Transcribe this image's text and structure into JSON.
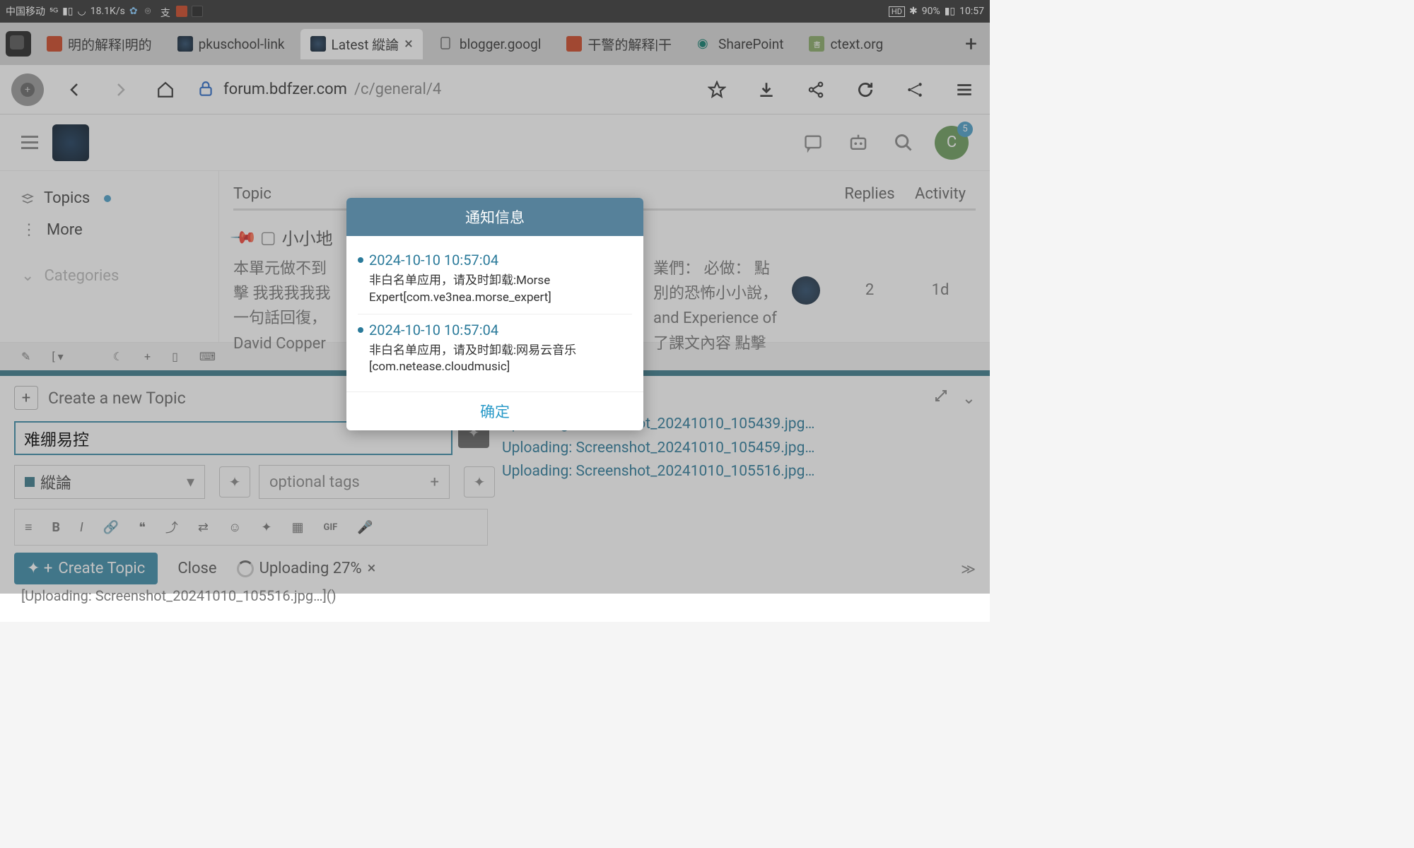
{
  "status": {
    "carrier": "中国移动",
    "speed": "18.1K/s",
    "hd": "HD",
    "battery": "90%",
    "time": "10:57"
  },
  "tabs": [
    {
      "label": "明的解释|明的",
      "favicon": "red"
    },
    {
      "label": "pkuschool-link",
      "favicon": "darklogo"
    },
    {
      "label": "Latest 縱論",
      "favicon": "darklogo",
      "active": true
    },
    {
      "label": "blogger.googl",
      "favicon": "doc"
    },
    {
      "label": "干警的解释|干",
      "favicon": "red"
    },
    {
      "label": "SharePoint",
      "favicon": "sp"
    },
    {
      "label": "ctext.org",
      "favicon": "ct"
    }
  ],
  "url": {
    "host": "forum.bdfzer.com",
    "path": "/c/general/4"
  },
  "page": {
    "avatar_letter": "C",
    "avatar_badge": "5",
    "sidebar": {
      "topics": "Topics",
      "more": "More",
      "categories": "Categories"
    },
    "columns": {
      "topic": "Topic",
      "replies": "Replies",
      "activity": "Activity"
    },
    "topic": {
      "title": "小小地",
      "body_left": "本單元做不到\n擊 我我我我我\n一句話回復，\nDavid Copper",
      "body_right": "業們： 必做： 點\n別的恐怖小小說，\nand Experience of\n了課文內容 點擊",
      "replies": "2",
      "activity": "1d"
    }
  },
  "composer": {
    "heading": "Create a new Topic",
    "title_value": "难绷易控",
    "category": "縱論",
    "tags_placeholder": "optional tags",
    "create_label": "Create Topic",
    "close_label": "Close",
    "uploading": "Uploading 27%",
    "preview": [
      "Uploading: Screenshot_20241010_105439.jpg…",
      "Uploading: Screenshot_20241010_105459.jpg…",
      "Uploading: Screenshot_20241010_105516.jpg…"
    ],
    "overflow": "[Uploading: Screenshot_20241010_105516.jpg…]()"
  },
  "modal": {
    "title": "通知信息",
    "items": [
      {
        "time": "2024-10-10 10:57:04",
        "text": "非白名单应用，请及时卸载:Morse Expert[com.ve3nea.morse_expert]"
      },
      {
        "time": "2024-10-10 10:57:04",
        "text": "非白名单应用，请及时卸载:网易云音乐[com.netease.cloudmusic]"
      }
    ],
    "confirm": "确定"
  }
}
